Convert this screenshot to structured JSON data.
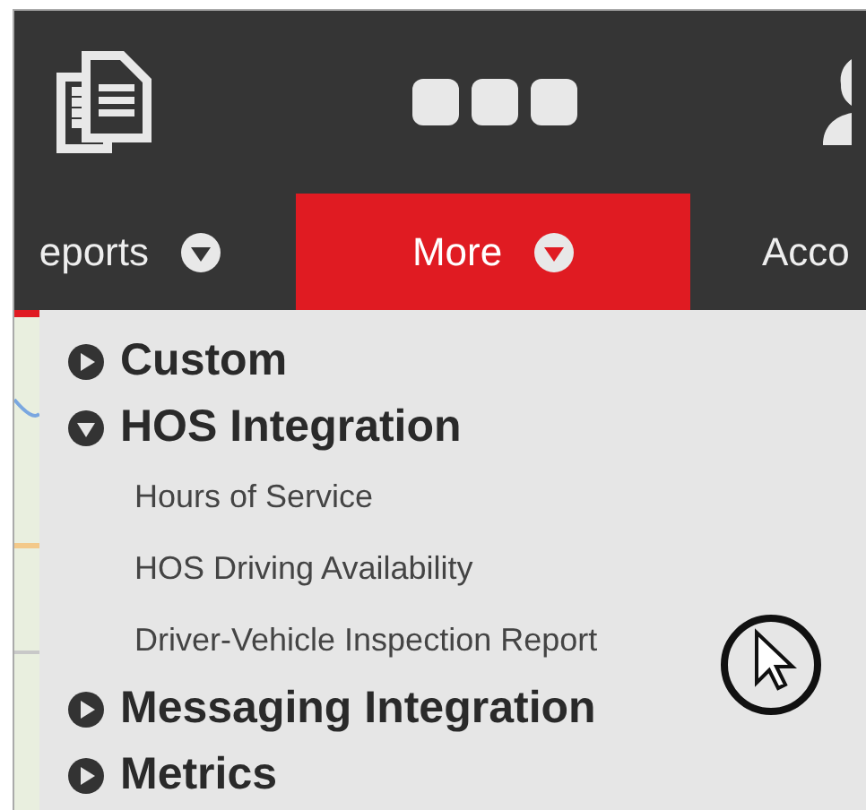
{
  "nav_tabs": [
    {
      "label": "eports",
      "selected": false,
      "caret": true
    },
    {
      "label": "More",
      "selected": true,
      "caret": true
    },
    {
      "label": "Acco",
      "selected": false,
      "caret": false
    }
  ],
  "menu": [
    {
      "label": "Custom",
      "expanded": false
    },
    {
      "label": "HOS Integration",
      "expanded": true,
      "children": [
        {
          "label": "Hours of Service"
        },
        {
          "label": "HOS Driving Availability"
        },
        {
          "label": "Driver-Vehicle Inspection Report"
        }
      ]
    },
    {
      "label": "Messaging Integration",
      "expanded": false
    },
    {
      "label": "Metrics",
      "expanded": false
    }
  ]
}
